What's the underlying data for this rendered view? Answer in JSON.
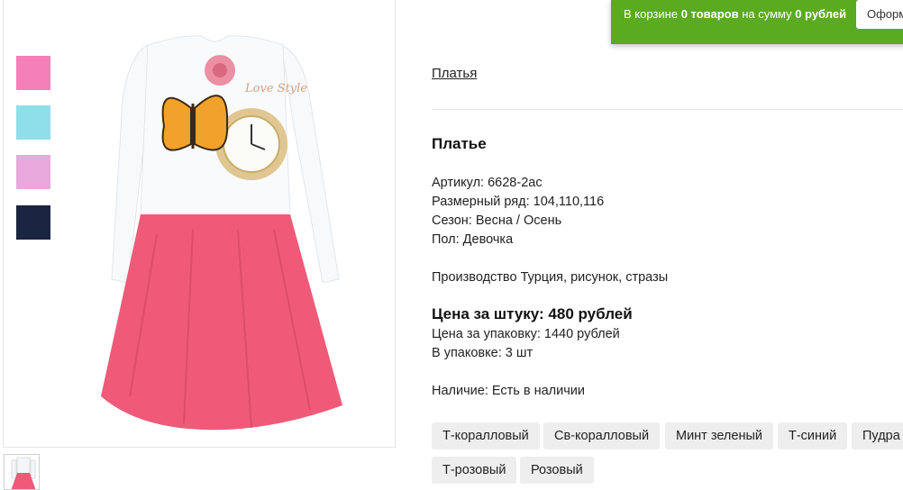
{
  "cart": {
    "prefix": "В корзине ",
    "count": "0 товаров",
    "middle": " на сумму ",
    "sum": "0 рублей",
    "checkout_label": "Оформ"
  },
  "breadcrumb": "Платья",
  "product": {
    "title": "Платье",
    "article": "Артикул: 6628-2ас",
    "sizes": "Размерный ряд: 104,110,116",
    "season": "Сезон: Весна / Осень",
    "gender": "Пол: Девочка",
    "production": "Производство Турция, рисунок, стразы",
    "price_unit": "Цена за штуку: 480 рублей",
    "price_pack": "Цена за упаковку: 1440 рублей",
    "pack_count": "В упаковке: 3 шт",
    "availability": "Наличие: Есть в наличии"
  },
  "image_print_text": "Love Style",
  "swatches": [
    "#f57fb8",
    "#8edfe9",
    "#e9a9dc",
    "#1b2541"
  ],
  "colors": [
    "Т-коралловый",
    "Св-коралловый",
    "Минт зеленый",
    "Т-синий",
    "Пудра",
    "Т-розовый",
    "Розовый"
  ]
}
